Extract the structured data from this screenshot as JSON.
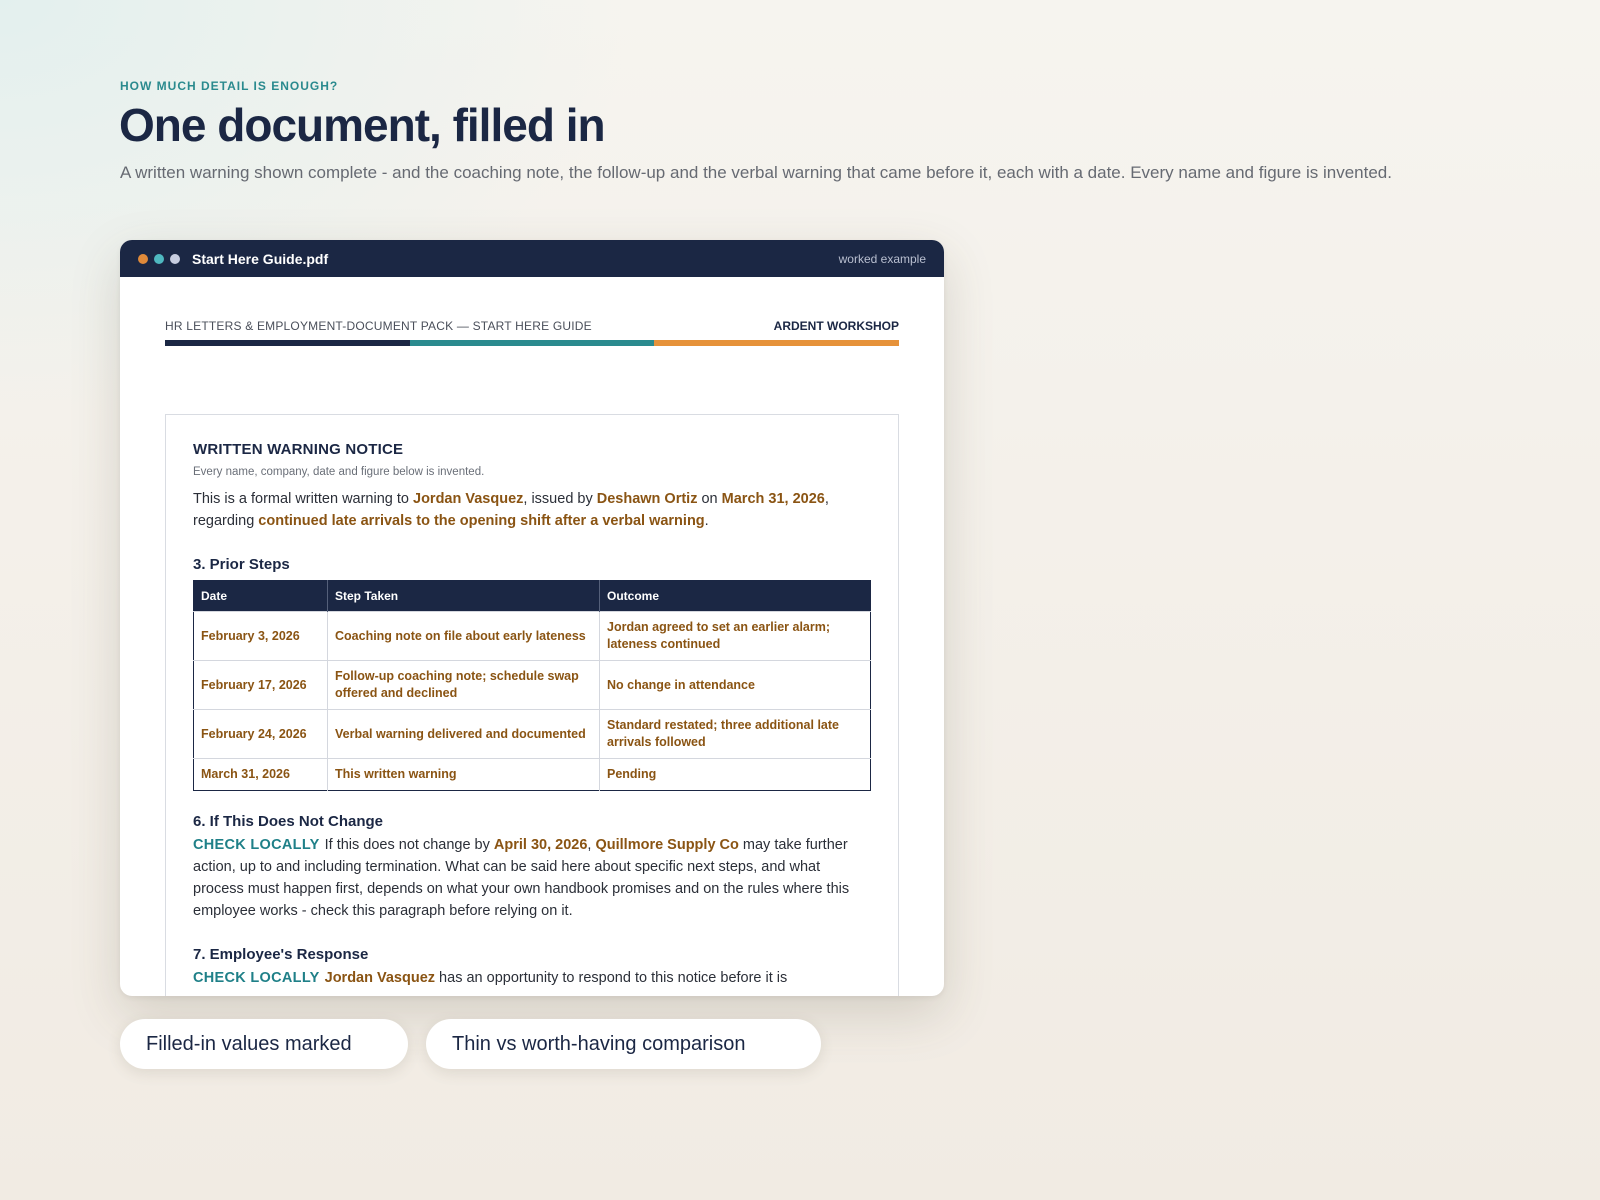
{
  "hero": {
    "kicker": "HOW MUCH DETAIL IS ENOUGH?",
    "title": "One document, filled in",
    "subtitle": "A written warning shown complete - and the coaching note, the follow-up and the verbal warning that came before it, each with a date. Every name and figure is invented."
  },
  "window": {
    "title": "Start Here Guide.pdf",
    "badge": "worked example"
  },
  "doc": {
    "header_left": "HR LETTERS & EMPLOYMENT-DOCUMENT PACK — START HERE GUIDE",
    "header_right": "ARDENT WORKSHOP",
    "notice_title": "WRITTEN WARNING NOTICE",
    "notice_note": "Every name, company, date and figure below is invented.",
    "intro": {
      "t1": "This is a formal written warning to ",
      "employee": "Jordan Vasquez",
      "t2": ", issued by ",
      "issuer": "Deshawn Ortiz",
      "t3": " on ",
      "date": "March 31, 2026",
      "t4": ", regarding ",
      "reason": "continued late arrivals to the opening shift after a verbal warning",
      "t5": "."
    },
    "prior_steps": {
      "heading": "3. Prior Steps",
      "columns": [
        "Date",
        "Step Taken",
        "Outcome"
      ],
      "rows": [
        {
          "date": "February 3, 2026",
          "step": "Coaching note on file about early lateness",
          "outcome": "Jordan agreed to set an earlier alarm; lateness continued"
        },
        {
          "date": "February 17, 2026",
          "step": "Follow-up coaching note; schedule swap offered and declined",
          "outcome": "No change in attendance"
        },
        {
          "date": "February 24, 2026",
          "step": "Verbal warning delivered and documented",
          "outcome": "Standard restated; three additional late arrivals followed"
        },
        {
          "date": "March 31, 2026",
          "step": "This written warning",
          "outcome": "Pending"
        }
      ]
    },
    "section6": {
      "heading": "6. If This Does Not Change",
      "tag": "CHECK LOCALLY",
      "t1": "If this does not change by ",
      "deadline": "April 30, 2026",
      "t2": ", ",
      "company": "Quillmore Supply Co",
      "t3": " may take further action, up to and including termination. What can be said here about specific next steps, and what process must happen first, depends on what your own handbook promises and on the rules where this employee works - check this paragraph before relying on it."
    },
    "section7": {
      "heading": "7. Employee's Response",
      "tag": "CHECK LOCALLY",
      "employee": "Jordan Vasquez",
      "t1": " has an opportunity to respond to this notice before it is"
    }
  },
  "pills": {
    "filled": "Filled-in values marked",
    "compare": "Thin vs worth-having comparison"
  },
  "colors": {
    "navy": "#1b2744",
    "teal": "#2a8a8e",
    "orange": "#e6923a",
    "filled_value": "#8a5413"
  }
}
